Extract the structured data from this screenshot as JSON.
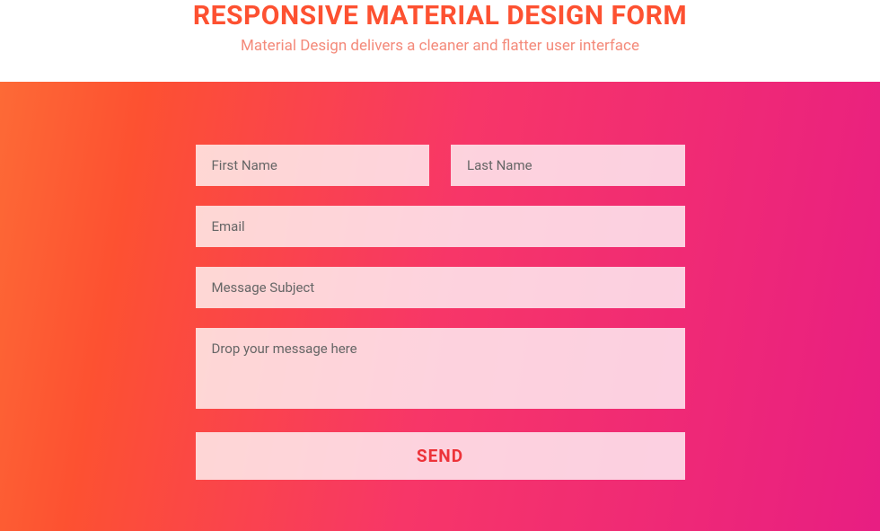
{
  "header": {
    "title": "RESPONSIVE MATERIAL DESIGN FORM",
    "subtitle": "Material Design delivers a cleaner and flatter user interface"
  },
  "form": {
    "first_name_placeholder": "First Name",
    "last_name_placeholder": "Last Name",
    "email_placeholder": "Email",
    "subject_placeholder": "Message Subject",
    "message_placeholder": "Drop your message here",
    "submit_label": "SEND"
  }
}
